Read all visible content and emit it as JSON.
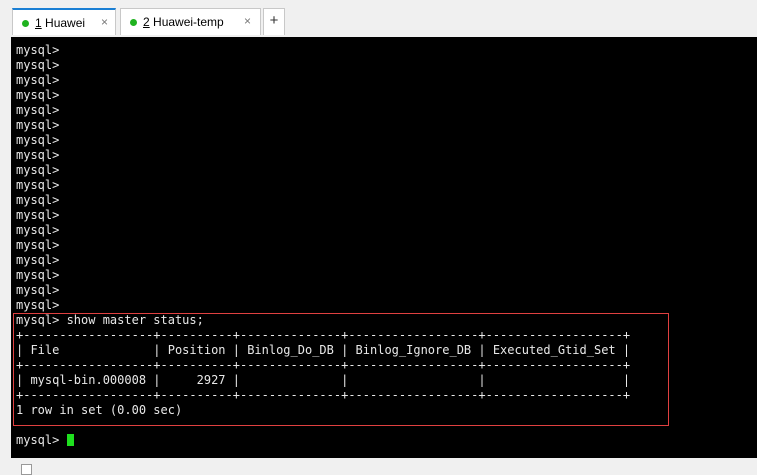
{
  "tabs": [
    {
      "number": "1",
      "title": "Huawei",
      "active": true
    },
    {
      "number": "2",
      "title": "Huawei-temp",
      "active": false
    }
  ],
  "tab_close_glyph": "×",
  "new_tab_glyph": "+",
  "terminal": {
    "prompt_lines": [
      "mysql>",
      "mysql>",
      "mysql>",
      "mysql>",
      "mysql>",
      "mysql>",
      "mysql>",
      "mysql>",
      "mysql>",
      "mysql>",
      "mysql>",
      "mysql>",
      "mysql>",
      "mysql>",
      "mysql>",
      "mysql>",
      "mysql>",
      "mysql>"
    ],
    "command_line": "mysql> show master status;",
    "result_lines": [
      "+------------------+----------+--------------+------------------+-------------------+",
      "| File             | Position | Binlog_Do_DB | Binlog_Ignore_DB | Executed_Gtid_Set |",
      "+------------------+----------+--------------+------------------+-------------------+",
      "| mysql-bin.000008 |     2927 |              |                  |                   |",
      "+------------------+----------+--------------+------------------+-------------------+",
      "1 row in set (0.00 sec)"
    ],
    "final_prompt": "mysql> ",
    "cursor_color": "#1fe01f"
  },
  "colors": {
    "active_tab_accent": "#1a7fd4",
    "session_dot": "#1fb21f",
    "highlight_border": "#e04040"
  }
}
